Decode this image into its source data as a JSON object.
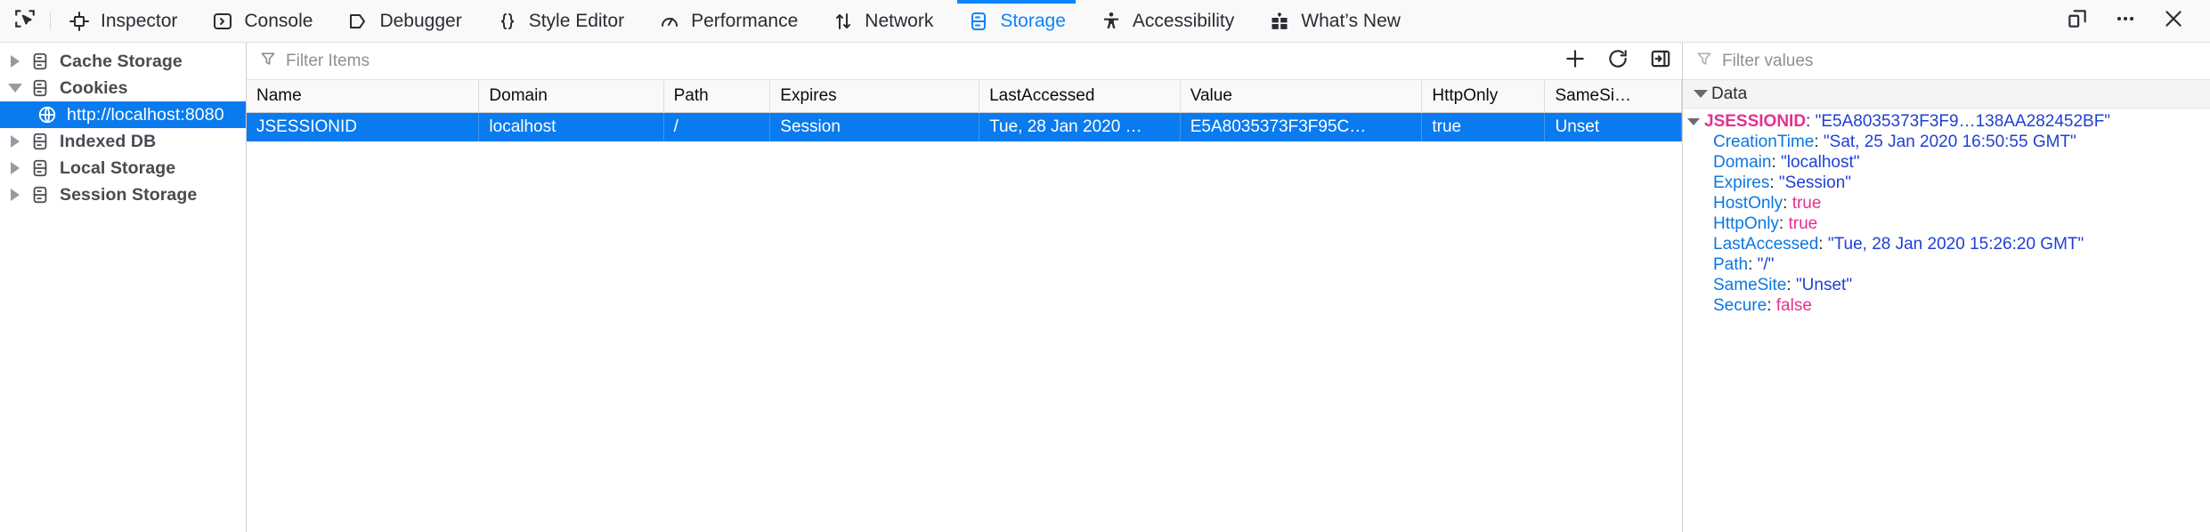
{
  "toolbar": {
    "picker_icon": "element-picker-icon",
    "tabs": [
      {
        "label": "Inspector",
        "icon": "inspector-icon",
        "active": false
      },
      {
        "label": "Console",
        "icon": "console-icon",
        "active": false
      },
      {
        "label": "Debugger",
        "icon": "debugger-icon",
        "active": false
      },
      {
        "label": "Style Editor",
        "icon": "style-editor-icon",
        "active": false
      },
      {
        "label": "Performance",
        "icon": "performance-icon",
        "active": false
      },
      {
        "label": "Network",
        "icon": "network-icon",
        "active": false
      },
      {
        "label": "Storage",
        "icon": "storage-icon",
        "active": true
      },
      {
        "label": "Accessibility",
        "icon": "accessibility-icon",
        "active": false
      },
      {
        "label": "What’s New",
        "icon": "gift-icon",
        "active": false
      }
    ],
    "right_buttons": [
      {
        "name": "dock-position-icon"
      },
      {
        "name": "meatball-menu-icon"
      },
      {
        "name": "close-icon"
      }
    ],
    "active_accent": "#0a84ff"
  },
  "sidebar": {
    "items": [
      {
        "label": "Cache Storage",
        "expanded": false,
        "selected": false,
        "child": false,
        "icon": "storage-db-icon"
      },
      {
        "label": "Cookies",
        "expanded": true,
        "selected": false,
        "child": false,
        "icon": "storage-db-icon"
      },
      {
        "label": "http://localhost:8080",
        "expanded": null,
        "selected": true,
        "child": true,
        "icon": "globe-icon"
      },
      {
        "label": "Indexed DB",
        "expanded": false,
        "selected": false,
        "child": false,
        "icon": "storage-db-icon"
      },
      {
        "label": "Local Storage",
        "expanded": false,
        "selected": false,
        "child": false,
        "icon": "storage-db-icon"
      },
      {
        "label": "Session Storage",
        "expanded": false,
        "selected": false,
        "child": false,
        "icon": "storage-db-icon"
      }
    ],
    "selected_bg": "#0a7bef"
  },
  "main": {
    "filter": {
      "placeholder": "Filter Items",
      "value": "",
      "icon": "filter-icon"
    },
    "actions": [
      {
        "name": "add-item-button",
        "icon": "plus-icon"
      },
      {
        "name": "refresh-button",
        "icon": "refresh-icon"
      },
      {
        "name": "toggle-sidebar-button",
        "icon": "panel-toggle-icon"
      }
    ],
    "columns": [
      "Name",
      "Domain",
      "Path",
      "Expires",
      "LastAccessed",
      "Value",
      "HttpOnly",
      "SameSi…"
    ],
    "rows": [
      {
        "selected": true,
        "cells": [
          "JSESSIONID",
          "localhost",
          "/",
          "Session",
          "Tue, 28 Jan 2020 …",
          "E5A8035373F3F95C…",
          "true",
          "Unset"
        ]
      }
    ]
  },
  "details": {
    "filter": {
      "placeholder": "Filter values",
      "value": "",
      "icon": "filter-icon"
    },
    "section_label": "Data",
    "root": {
      "key": "JSESSIONID",
      "value": "\"E5A8035373F3F9…138AA282452BF\"",
      "expanded": true
    },
    "properties": [
      {
        "key": "CreationTime",
        "value": "\"Sat, 25 Jan 2020 16:50:55 GMT\"",
        "type": "string"
      },
      {
        "key": "Domain",
        "value": "\"localhost\"",
        "type": "string"
      },
      {
        "key": "Expires",
        "value": "\"Session\"",
        "type": "string"
      },
      {
        "key": "HostOnly",
        "value": "true",
        "type": "bool"
      },
      {
        "key": "HttpOnly",
        "value": "true",
        "type": "bool"
      },
      {
        "key": "LastAccessed",
        "value": "\"Tue, 28 Jan 2020 15:26:20 GMT\"",
        "type": "string"
      },
      {
        "key": "Path",
        "value": "\"/\"",
        "type": "string"
      },
      {
        "key": "SameSite",
        "value": "\"Unset\"",
        "type": "string"
      },
      {
        "key": "Secure",
        "value": "false",
        "type": "bool"
      }
    ],
    "colors": {
      "key_root": "#e4308f",
      "key_child": "#0b77e0",
      "string": "#1e3fd6",
      "bool": "#e4308f"
    }
  }
}
